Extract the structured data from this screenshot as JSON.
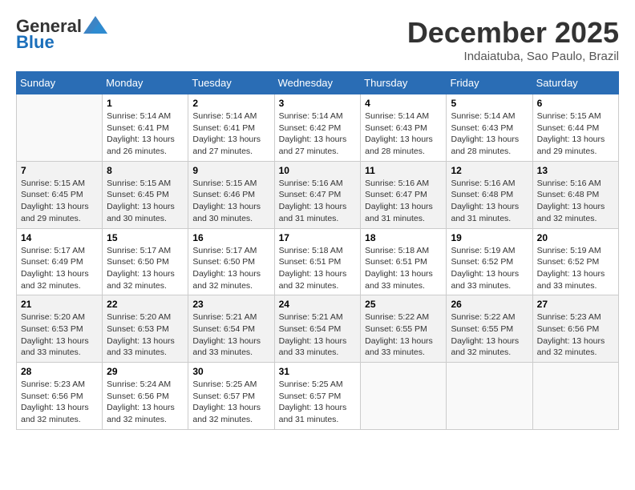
{
  "header": {
    "logo_general": "General",
    "logo_blue": "Blue",
    "month_year": "December 2025",
    "location": "Indaiatuba, Sao Paulo, Brazil"
  },
  "weekdays": [
    "Sunday",
    "Monday",
    "Tuesday",
    "Wednesday",
    "Thursday",
    "Friday",
    "Saturday"
  ],
  "weeks": [
    [
      {
        "day": "",
        "sunrise": "",
        "sunset": "",
        "daylight": ""
      },
      {
        "day": "1",
        "sunrise": "Sunrise: 5:14 AM",
        "sunset": "Sunset: 6:41 PM",
        "daylight": "Daylight: 13 hours and 26 minutes."
      },
      {
        "day": "2",
        "sunrise": "Sunrise: 5:14 AM",
        "sunset": "Sunset: 6:41 PM",
        "daylight": "Daylight: 13 hours and 27 minutes."
      },
      {
        "day": "3",
        "sunrise": "Sunrise: 5:14 AM",
        "sunset": "Sunset: 6:42 PM",
        "daylight": "Daylight: 13 hours and 27 minutes."
      },
      {
        "day": "4",
        "sunrise": "Sunrise: 5:14 AM",
        "sunset": "Sunset: 6:43 PM",
        "daylight": "Daylight: 13 hours and 28 minutes."
      },
      {
        "day": "5",
        "sunrise": "Sunrise: 5:14 AM",
        "sunset": "Sunset: 6:43 PM",
        "daylight": "Daylight: 13 hours and 28 minutes."
      },
      {
        "day": "6",
        "sunrise": "Sunrise: 5:15 AM",
        "sunset": "Sunset: 6:44 PM",
        "daylight": "Daylight: 13 hours and 29 minutes."
      }
    ],
    [
      {
        "day": "7",
        "sunrise": "Sunrise: 5:15 AM",
        "sunset": "Sunset: 6:45 PM",
        "daylight": "Daylight: 13 hours and 29 minutes."
      },
      {
        "day": "8",
        "sunrise": "Sunrise: 5:15 AM",
        "sunset": "Sunset: 6:45 PM",
        "daylight": "Daylight: 13 hours and 30 minutes."
      },
      {
        "day": "9",
        "sunrise": "Sunrise: 5:15 AM",
        "sunset": "Sunset: 6:46 PM",
        "daylight": "Daylight: 13 hours and 30 minutes."
      },
      {
        "day": "10",
        "sunrise": "Sunrise: 5:16 AM",
        "sunset": "Sunset: 6:47 PM",
        "daylight": "Daylight: 13 hours and 31 minutes."
      },
      {
        "day": "11",
        "sunrise": "Sunrise: 5:16 AM",
        "sunset": "Sunset: 6:47 PM",
        "daylight": "Daylight: 13 hours and 31 minutes."
      },
      {
        "day": "12",
        "sunrise": "Sunrise: 5:16 AM",
        "sunset": "Sunset: 6:48 PM",
        "daylight": "Daylight: 13 hours and 31 minutes."
      },
      {
        "day": "13",
        "sunrise": "Sunrise: 5:16 AM",
        "sunset": "Sunset: 6:48 PM",
        "daylight": "Daylight: 13 hours and 32 minutes."
      }
    ],
    [
      {
        "day": "14",
        "sunrise": "Sunrise: 5:17 AM",
        "sunset": "Sunset: 6:49 PM",
        "daylight": "Daylight: 13 hours and 32 minutes."
      },
      {
        "day": "15",
        "sunrise": "Sunrise: 5:17 AM",
        "sunset": "Sunset: 6:50 PM",
        "daylight": "Daylight: 13 hours and 32 minutes."
      },
      {
        "day": "16",
        "sunrise": "Sunrise: 5:17 AM",
        "sunset": "Sunset: 6:50 PM",
        "daylight": "Daylight: 13 hours and 32 minutes."
      },
      {
        "day": "17",
        "sunrise": "Sunrise: 5:18 AM",
        "sunset": "Sunset: 6:51 PM",
        "daylight": "Daylight: 13 hours and 32 minutes."
      },
      {
        "day": "18",
        "sunrise": "Sunrise: 5:18 AM",
        "sunset": "Sunset: 6:51 PM",
        "daylight": "Daylight: 13 hours and 33 minutes."
      },
      {
        "day": "19",
        "sunrise": "Sunrise: 5:19 AM",
        "sunset": "Sunset: 6:52 PM",
        "daylight": "Daylight: 13 hours and 33 minutes."
      },
      {
        "day": "20",
        "sunrise": "Sunrise: 5:19 AM",
        "sunset": "Sunset: 6:52 PM",
        "daylight": "Daylight: 13 hours and 33 minutes."
      }
    ],
    [
      {
        "day": "21",
        "sunrise": "Sunrise: 5:20 AM",
        "sunset": "Sunset: 6:53 PM",
        "daylight": "Daylight: 13 hours and 33 minutes."
      },
      {
        "day": "22",
        "sunrise": "Sunrise: 5:20 AM",
        "sunset": "Sunset: 6:53 PM",
        "daylight": "Daylight: 13 hours and 33 minutes."
      },
      {
        "day": "23",
        "sunrise": "Sunrise: 5:21 AM",
        "sunset": "Sunset: 6:54 PM",
        "daylight": "Daylight: 13 hours and 33 minutes."
      },
      {
        "day": "24",
        "sunrise": "Sunrise: 5:21 AM",
        "sunset": "Sunset: 6:54 PM",
        "daylight": "Daylight: 13 hours and 33 minutes."
      },
      {
        "day": "25",
        "sunrise": "Sunrise: 5:22 AM",
        "sunset": "Sunset: 6:55 PM",
        "daylight": "Daylight: 13 hours and 33 minutes."
      },
      {
        "day": "26",
        "sunrise": "Sunrise: 5:22 AM",
        "sunset": "Sunset: 6:55 PM",
        "daylight": "Daylight: 13 hours and 32 minutes."
      },
      {
        "day": "27",
        "sunrise": "Sunrise: 5:23 AM",
        "sunset": "Sunset: 6:56 PM",
        "daylight": "Daylight: 13 hours and 32 minutes."
      }
    ],
    [
      {
        "day": "28",
        "sunrise": "Sunrise: 5:23 AM",
        "sunset": "Sunset: 6:56 PM",
        "daylight": "Daylight: 13 hours and 32 minutes."
      },
      {
        "day": "29",
        "sunrise": "Sunrise: 5:24 AM",
        "sunset": "Sunset: 6:56 PM",
        "daylight": "Daylight: 13 hours and 32 minutes."
      },
      {
        "day": "30",
        "sunrise": "Sunrise: 5:25 AM",
        "sunset": "Sunset: 6:57 PM",
        "daylight": "Daylight: 13 hours and 32 minutes."
      },
      {
        "day": "31",
        "sunrise": "Sunrise: 5:25 AM",
        "sunset": "Sunset: 6:57 PM",
        "daylight": "Daylight: 13 hours and 31 minutes."
      },
      {
        "day": "",
        "sunrise": "",
        "sunset": "",
        "daylight": ""
      },
      {
        "day": "",
        "sunrise": "",
        "sunset": "",
        "daylight": ""
      },
      {
        "day": "",
        "sunrise": "",
        "sunset": "",
        "daylight": ""
      }
    ]
  ]
}
